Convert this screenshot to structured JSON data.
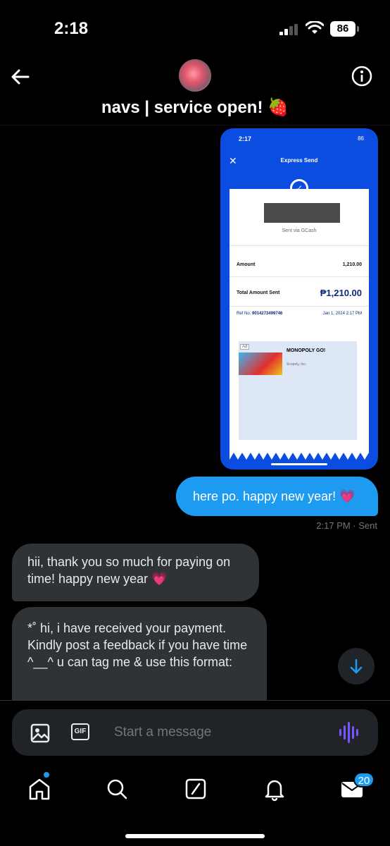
{
  "status_bar": {
    "time": "2:18",
    "battery": "86"
  },
  "header": {
    "contact_name": "navs | service open! 🍓"
  },
  "screenshot": {
    "time": "2:17",
    "battery": "86",
    "title": "Express Send",
    "sent_via": "Sent via GCash",
    "amount_label": "Amount",
    "amount_value": "1,210.00",
    "total_label": "Total Amount Sent",
    "total_value": "₱1,210.00",
    "ref_label": "Ref No.",
    "ref_number": "9014273499746",
    "ref_date": "Jan 1, 2024 2:17 PM",
    "ad_tag": "Ad",
    "ad_title": "MONOPOLY GO!",
    "ad_subtitle": "Scopely, Inc."
  },
  "messages": {
    "outgoing_text": "here po. happy new year! 💗",
    "outgoing_meta": "2:17 PM · Sent",
    "incoming_1": "hii, thank you so much for paying on time! happy new year 💗",
    "incoming_2": "*˚ hi, i have received your payment. Kindly post a feedback if you have time ^__^ u can tag me & use this format:"
  },
  "composer": {
    "placeholder": "Start a message",
    "gif_label": "GIF"
  },
  "tabbar": {
    "messages_badge": "20"
  },
  "colors": {
    "accent": "#1d9bf0",
    "bubble_in": "#2f3336",
    "voice": "#7856ff"
  }
}
